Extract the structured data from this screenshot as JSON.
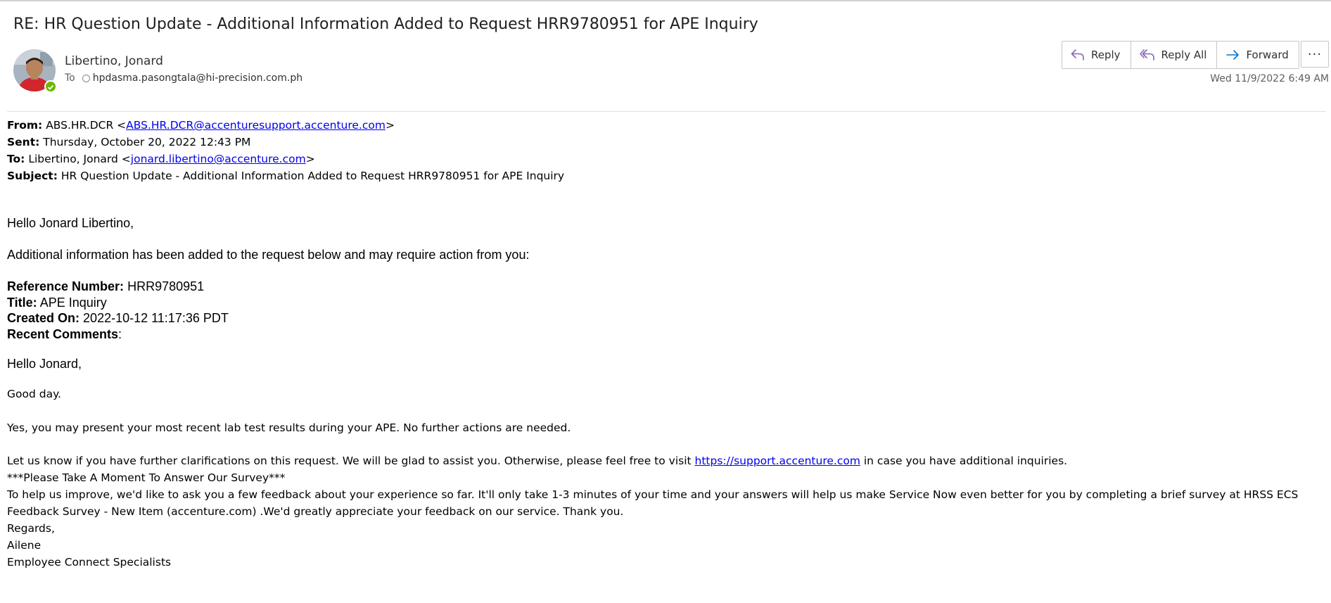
{
  "email": {
    "subject": "RE: HR Question Update - Additional Information Added to Request HRR9780951 for APE Inquiry",
    "sender": "Libertino, Jonard",
    "to_label": "To",
    "to_address": "hpdasma.pasongtala@hi-precision.com.ph",
    "timestamp": "Wed 11/9/2022 6:49 AM"
  },
  "actions": {
    "reply": "Reply",
    "reply_all": "Reply All",
    "forward": "Forward",
    "more": "···"
  },
  "forwarded": {
    "from_label": "From:",
    "from_name": "ABS.HR.DCR <",
    "from_email": "ABS.HR.DCR@accenturesupport.accenture.com",
    "from_close": ">",
    "sent_label": "Sent:",
    "sent_value": "Thursday, October 20, 2022 12:43 PM",
    "to_label": "To:",
    "to_name": "Libertino, Jonard <",
    "to_email": "jonard.libertino@accenture.com",
    "to_close": ">",
    "subject_label": "Subject:",
    "subject_value": "HR Question Update - Additional Information Added to Request HRR9780951 for APE Inquiry"
  },
  "content": {
    "greeting": "Hello Jonard Libertino,",
    "intro": "Additional information has been added to the request below and may require action from you:",
    "ref_label": "Reference Number:",
    "ref_value": "HRR9780951",
    "title_label": "Title:",
    "title_value": "APE Inquiry",
    "created_label": "Created On:",
    "created_value": "2022-10-12 11:17:36 PDT",
    "comments_label": "Recent Comments",
    "comments_colon": ":",
    "hello": "Hello Jonard,",
    "good_day": "Good day.",
    "answer": "Yes, you may present your most recent lab test results during your APE. No further actions are needed.",
    "clarify_before": "Let us know if you have further clarifications on this request. We will be glad to assist you. Otherwise, please feel free to visit",
    "clarify_link": "https://support.accenture.com",
    "clarify_after": "in case you have additional inquiries.",
    "survey_heading": "***Please Take A Moment To Answer Our Survey***",
    "survey_text": "To help us improve, we'd like to ask you a few feedback about your experience so far. It'll only take 1-3 minutes of your time and your answers will help us make Service Now even better for you by completing a brief survey at HRSS ECS Feedback Survey - New Item (accenture.com) .We'd greatly appreciate your feedback on our service. Thank you.",
    "regards": "Regards,",
    "signer": "Ailene",
    "team": "Employee Connect Specialists"
  },
  "colors": {
    "accent_reply": "#8764b8",
    "accent_forward": "#0078d4",
    "presence": "#6bb700",
    "link": "#0000ee"
  },
  "icons": [
    "reply-icon",
    "reply-all-icon",
    "forward-icon",
    "more-icon",
    "presence-icon"
  ]
}
